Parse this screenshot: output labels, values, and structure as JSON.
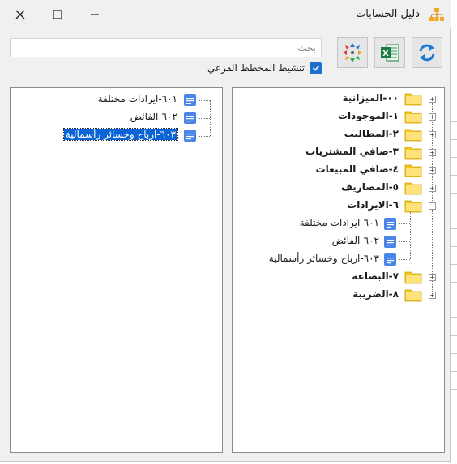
{
  "window": {
    "title": "دليل الحسابات",
    "close_glyph": "✕",
    "maximize_glyph": "☐",
    "minimize_glyph": "—"
  },
  "search": {
    "placeholder": "بحث",
    "value": ""
  },
  "toolbar": {
    "refresh_icon": "refresh-icon",
    "excel_icon": "excel-icon",
    "move_icon": "move-arrows-icon",
    "excel_letter": "X"
  },
  "branch_toggle": {
    "label": "تنشيط المخطط الفرعي",
    "checked": true
  },
  "tree_main": {
    "items": [
      {
        "label": "٠٠-الميزانية",
        "expander": "+"
      },
      {
        "label": "١-الموجودات",
        "expander": "+"
      },
      {
        "label": "٢-المطاليب",
        "expander": "+"
      },
      {
        "label": "٣-صافي المشتريات",
        "expander": "+"
      },
      {
        "label": "٤-صافي المبيعات",
        "expander": "+"
      },
      {
        "label": "٥-المصاريف",
        "expander": "+"
      },
      {
        "label": "٦-الايرادات",
        "expander": "−"
      },
      {
        "label": "٦٠١-ايرادات مختلفة"
      },
      {
        "label": "٦٠٢-الفائض"
      },
      {
        "label": "٦٠٣-ارباح وخسائر رأسمالية"
      },
      {
        "label": "٧-البضاعة",
        "expander": "+"
      },
      {
        "label": "٨-الضريبة",
        "expander": "+"
      }
    ]
  },
  "tree_sub": {
    "items": [
      {
        "label": "٦٠١-ايرادات مختلفة"
      },
      {
        "label": "٦٠٢-الفائض"
      },
      {
        "label": "٦٠٣-ارباح وخسائر رأسمالية",
        "selected": true
      }
    ]
  },
  "colors": {
    "folder": "#f5c518",
    "leaf_icon": "#4a86e8",
    "selection": "#0a64d6",
    "accent": "#1f6fd1"
  }
}
